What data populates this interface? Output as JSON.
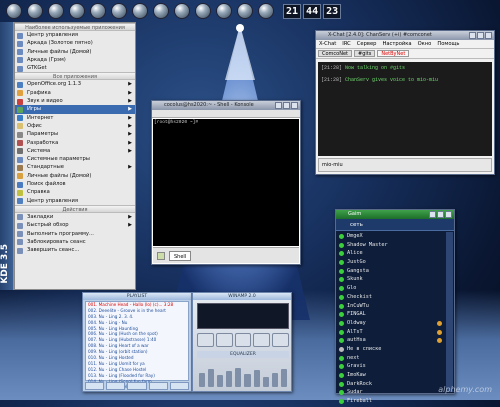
{
  "topbar": {
    "icons": [
      "kde-icon",
      "home-icon",
      "terminal-icon",
      "browser-icon",
      "media-icon",
      "chat-icon",
      "settings-icon",
      "mail-icon",
      "network-icon",
      "shield-icon",
      "tools-icon",
      "close-icon",
      "volume-icon"
    ],
    "clock": {
      "h": "21",
      "m": "44",
      "s": "23"
    }
  },
  "kicker": {
    "label": "KDE 3.5"
  },
  "menu": {
    "header_recent": "Наиболее используемые приложения",
    "recent": [
      "Центр управления",
      "Аркада (Золотое пятно)",
      "Личные файлы (Домой)",
      "Аркада (Грэм)",
      "GTKGet"
    ],
    "header_all": "Все приложения",
    "apps": [
      {
        "label": "OpenOffice.org 1.1.3",
        "color": "#4b7fc1",
        "sub": true
      },
      {
        "label": "Графика",
        "color": "#e0a040",
        "sub": true
      },
      {
        "label": "Звук и видео",
        "color": "#c84040",
        "sub": true
      },
      {
        "label": "Игры",
        "color": "#5aa55a",
        "sub": true,
        "selected": true
      },
      {
        "label": "Интернет",
        "color": "#3c7dc8",
        "sub": true
      },
      {
        "label": "Офис",
        "color": "#d8c070",
        "sub": true
      },
      {
        "label": "Параметры",
        "color": "#888888",
        "sub": true
      },
      {
        "label": "Разработка",
        "color": "#b05050",
        "sub": true
      },
      {
        "label": "Система",
        "color": "#707070",
        "sub": true
      },
      {
        "label": "Системные параметры",
        "color": "#6a8ac0",
        "sub": false
      },
      {
        "label": "Стандартные",
        "color": "#9a7a50",
        "sub": true
      },
      {
        "label": "Личные файлы (Домой)",
        "color": "#d8a040",
        "sub": false
      },
      {
        "label": "Поиск файлов",
        "color": "#4a7ac0",
        "sub": false
      },
      {
        "label": "Справка",
        "color": "#c0c040",
        "sub": false
      },
      {
        "label": "Центр управления",
        "color": "#5080c0",
        "sub": false
      }
    ],
    "header_actions": "Действия",
    "actions": [
      {
        "label": "Закладки",
        "sub": true
      },
      {
        "label": "Быстрый обзор",
        "sub": true
      },
      {
        "label": "Выполнить программу...",
        "sub": false
      },
      {
        "label": "Заблокировать сеанс",
        "sub": false
      },
      {
        "label": "Завершить сеанс...",
        "sub": false
      }
    ]
  },
  "terminal": {
    "title": "cocolus@hs2020:~ - Shell - Konsole",
    "prompt": "[root@hs2020 ~]# ",
    "tab": "Shell"
  },
  "xchat": {
    "title": "X-Chat [2.4.0]: ChanServ (+i) #comconet",
    "menus": [
      "X-Chat",
      "IRC",
      "Сервер",
      "Настройка",
      "Окно",
      "Помощь"
    ],
    "tabs": [
      {
        "label": "ComcoNet",
        "active": false
      },
      {
        "label": "#gits",
        "active": false
      },
      {
        "label": "NetByNet",
        "active": true
      }
    ],
    "log": [
      {
        "time": "[21:28]",
        "text": "Now talking on #gits"
      },
      {
        "time": "[21:28]",
        "text": "ChanServ gives voice to mio-miu"
      }
    ],
    "nick": "mio-miu"
  },
  "buddy": {
    "title": "Gaim",
    "header": "сеть",
    "items": [
      {
        "name": "DmgeX",
        "color": "#3ccf3c",
        "extra": false
      },
      {
        "name": "Shadow Master",
        "color": "#3ccf3c",
        "extra": false
      },
      {
        "name": "Alice",
        "color": "#3ccf3c",
        "extra": false
      },
      {
        "name": "JustGo",
        "color": "#3ccf3c",
        "extra": false
      },
      {
        "name": "Gangsta",
        "color": "#3ccf3c",
        "extra": false
      },
      {
        "name": "Skunk",
        "color": "#3ccf3c",
        "extra": false
      },
      {
        "name": "Glo",
        "color": "#3ccf3c",
        "extra": false
      },
      {
        "name": "Checkist",
        "color": "#3ccf3c",
        "extra": false
      },
      {
        "name": "InCuWTu",
        "color": "#3ccf3c",
        "extra": false
      },
      {
        "name": "FINGAL",
        "color": "#3ccf3c",
        "extra": false
      },
      {
        "name": "Oldway",
        "color": "#3ccf3c",
        "extra": true
      },
      {
        "name": "AlTsT",
        "color": "#3ccf3c",
        "extra": true
      },
      {
        "name": "autHsa",
        "color": "#3ccf3c",
        "extra": true
      },
      {
        "name": "Не в списке",
        "color": "#bbbbbb",
        "extra": false
      },
      {
        "name": "next",
        "color": "#3ccf3c",
        "extra": false
      },
      {
        "name": "Gravis",
        "color": "#3ccf3c",
        "extra": false
      },
      {
        "name": "ImoKaw",
        "color": "#3ccf3c",
        "extra": false
      },
      {
        "name": "DarkRock",
        "color": "#3ccf3c",
        "extra": false
      },
      {
        "name": "Sudar",
        "color": "#3ccf3c",
        "extra": false
      },
      {
        "name": "Fireball",
        "color": "#3ccf3c",
        "extra": false
      }
    ]
  },
  "playlist": {
    "title": "PLAYLIST",
    "items": [
      "001. Machine Head - Hallo (lo) (c)... 3:28",
      "002. Deeelite - Groove is in the heart",
      "003. Nu - Ling 2. 3. 4.",
      "004. Nu - Ling - Nu",
      "005. Nu - Ling Haunting",
      "006. Nu - Ling (Hush on the spot)",
      "007. Nu - Ling (Hubstrasse) 1:40",
      "008. Nu - Ling Heart of a war",
      "009. Nu - Ling (orbit station)",
      "010. Nu - Ling Hosted",
      "011. Nu - Ling Uomit for ya",
      "012. Nu - Ling Chase Hostel",
      "013. Nu - Ling (Flooded for Ray)",
      "014. Nu - Ling (Song) fun farm",
      "015. Nu - Ling (Hello"
    ],
    "current": 0
  },
  "winamp": {
    "title": "WINAMP 2.0",
    "eq_label": "EQUALIZER",
    "eq_levels": [
      0.55,
      0.7,
      0.45,
      0.6,
      0.75,
      0.5,
      0.65,
      0.4,
      0.55,
      0.7
    ]
  },
  "watermark": "alphemy.com"
}
